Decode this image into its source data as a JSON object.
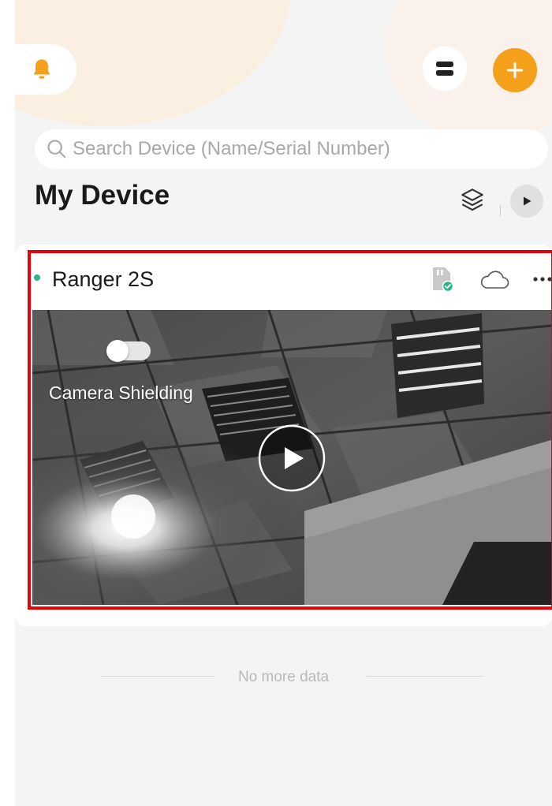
{
  "search": {
    "placeholder": "Search Device (Name/Serial Number)"
  },
  "section": {
    "title": "My Device"
  },
  "device": {
    "name": "Ranger 2S",
    "status": "online",
    "status_color": "#2bb58a",
    "camera_shielding_label": "Camera Shielding",
    "camera_shielding_on": false
  },
  "footer": {
    "text": "No more data"
  },
  "icons": {
    "bell": "bell-icon",
    "menu": "menu-icon",
    "add": "plus-icon",
    "search": "search-icon",
    "layers": "layers-icon",
    "play": "play-icon",
    "sd_card": "sd-card-icon",
    "cloud": "cloud-icon",
    "more": "more-icon"
  },
  "colors": {
    "accent": "#f5a01a",
    "highlight_border": "#e8000b"
  }
}
